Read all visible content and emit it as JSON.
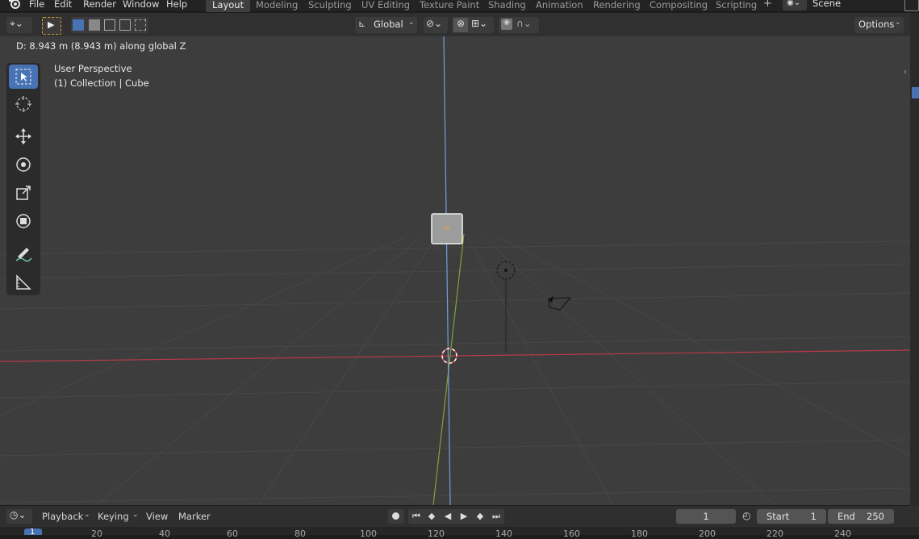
{
  "menu": {
    "items": [
      "File",
      "Edit",
      "Render",
      "Window",
      "Help"
    ]
  },
  "workspaces": {
    "tabs": [
      "Layout",
      "Modeling",
      "Sculpting",
      "UV Editing",
      "Texture Paint",
      "Shading",
      "Animation",
      "Rendering",
      "Compositing",
      "Scripting"
    ],
    "active": "Layout",
    "add_label": "+"
  },
  "scene": {
    "name": "Scene"
  },
  "header": {
    "transform_orientation": "Global",
    "options_label": "Options"
  },
  "status": {
    "transform_text": "D: 8.943 m (8.943 m) along global Z"
  },
  "viewport": {
    "perspective_label": "User Perspective",
    "collection_label": "(1) Collection | Cube"
  },
  "colors": {
    "accent": "#4772b3",
    "x_axis": "#b83a47",
    "y_axis": "#7ea33a",
    "z_axis": "#6fa0dc",
    "viewport_bg": "#3d3d3d"
  },
  "timeline": {
    "playback_label": "Playback",
    "keying_label": "Keying",
    "view_label": "View",
    "marker_label": "Marker",
    "current_frame": "1",
    "start_label": "Start",
    "start_value": "1",
    "end_label": "End",
    "end_value": "250",
    "ruler_current": "1",
    "ruler_ticks": [
      "20",
      "40",
      "60",
      "80",
      "100",
      "120",
      "140",
      "160",
      "180",
      "200",
      "220",
      "240"
    ]
  }
}
